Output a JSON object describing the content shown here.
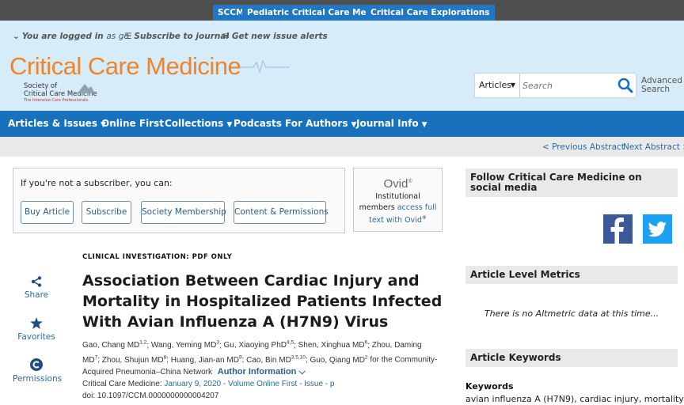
{
  "topbar": {
    "tabs": [
      "SCCM",
      "Pediatric Critical Care Medicine",
      "Critical Care Explorations"
    ]
  },
  "header": {
    "logged_in": "You are logged in",
    "logged_in_as": "as",
    "logged_in_user": "go",
    "subscribe": "Subscribe to journal",
    "alerts": "Get new issue alerts",
    "logo": "Critical Care Medicine",
    "society_line1": "Society of",
    "society_line2": "Critical Care Medicine",
    "society_tagline": "The Intensive Care Professionals"
  },
  "search": {
    "scope": "Articles",
    "placeholder": "Search",
    "advanced_line1": "Advanced",
    "advanced_line2": "Search"
  },
  "nav": {
    "items": [
      "Articles & Issues",
      "Online First",
      "Collections",
      "Podcasts",
      "For Authors",
      "Journal Info"
    ]
  },
  "prevnext": {
    "prev": "< Previous Abstract",
    "next": "Next Abstract >"
  },
  "subscribe_box": {
    "intro": "If you're not a subscriber, you can:",
    "buttons": [
      "Buy Article",
      "Subscribe",
      "Society Membership",
      "Content & Permissions"
    ]
  },
  "ovid": {
    "brand": "Ovid",
    "line1": "Institutional",
    "line2": "members",
    "link1": "access full",
    "link2": "text with Ovid"
  },
  "tools": {
    "share": "Share",
    "favorites": "Favorites",
    "permissions": "Permissions"
  },
  "article": {
    "label": "CLINICAL INVESTIGATION: PDF ONLY",
    "title": "Association Between Cardiac Injury and Mortality in Hospitalized Patients Infected With Avian Influenza A (H7N9) Virus",
    "author_info": "Author Information",
    "citation_journal": "Critical Care Medicine:",
    "citation_link": "January 9, 2020 - Volume Online First - Issue - p",
    "doi": "doi: 10.1097/CCM.0000000000004207"
  },
  "authors": [
    {
      "name": "Gao, Chang MD",
      "sup": "1,2"
    },
    {
      "name": "Wang, Yeming MD",
      "sup": "3"
    },
    {
      "name": "Gu, Xiaoying PhD",
      "sup": "4,5"
    },
    {
      "name": "Shen, Xinghua MD",
      "sup": "6"
    },
    {
      "name": "Zhou, Daming MD",
      "sup": "7"
    },
    {
      "name": "Zhou, Shujun MD",
      "sup": "8"
    },
    {
      "name": "Huang, Jian-an MD",
      "sup": "9"
    },
    {
      "name": "Cao, Bin MD",
      "sup": "3,5,10"
    },
    {
      "name": "Guo, Qiang MD",
      "sup": "2"
    }
  ],
  "authors_tail": "for the Community-Acquired Pneumonia–China Network",
  "sidebar": {
    "follow": "Follow Critical Care Medicine on social media",
    "metrics_heading": "Article Level Metrics",
    "altmetric": "There is no Altmetric data at this time...",
    "keywords_heading": "Article Keywords",
    "keywords_label": "Keywords",
    "keywords": "avian influenza A (H7N9), cardiac injury, mortality"
  },
  "colors": {
    "nav": "#1771bd",
    "header": "#d6ecf8",
    "logo": "#f0842b",
    "facebook": "#3b5998",
    "twitter": "#1da1f2"
  }
}
